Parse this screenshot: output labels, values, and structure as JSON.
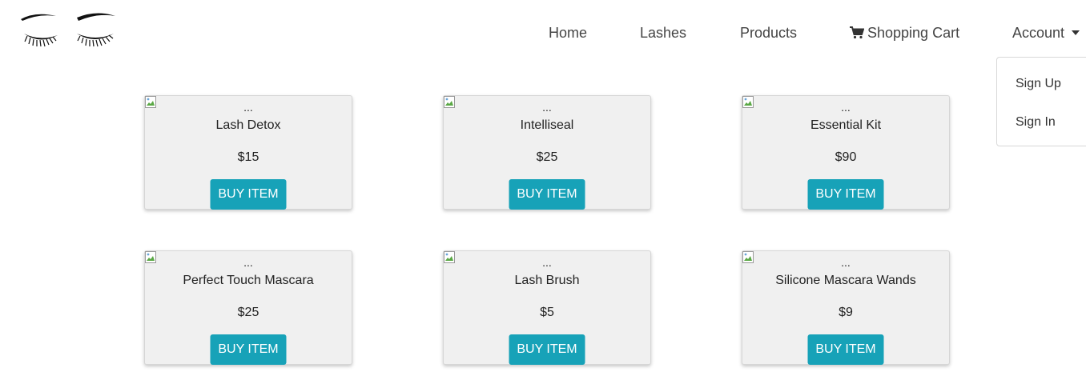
{
  "nav": {
    "home": "Home",
    "lashes": "Lashes",
    "products": "Products",
    "cart": "Shopping Cart",
    "account": "Account"
  },
  "account_menu": {
    "items": [
      "Sign Up",
      "Sign In"
    ]
  },
  "products": [
    {
      "alt": "...",
      "name": "Lash Detox",
      "price": "$15",
      "button": "BUY ITEM"
    },
    {
      "alt": "...",
      "name": "Intelliseal",
      "price": "$25",
      "button": "BUY ITEM"
    },
    {
      "alt": "...",
      "name": "Essential Kit",
      "price": "$90",
      "button": "BUY ITEM"
    },
    {
      "alt": "...",
      "name": "Perfect Touch Mascara",
      "price": "$25",
      "button": "BUY ITEM"
    },
    {
      "alt": "...",
      "name": "Lash Brush",
      "price": "$5",
      "button": "BUY ITEM"
    },
    {
      "alt": "...",
      "name": "Silicone Mascara Wands",
      "price": "$9",
      "button": "BUY ITEM"
    }
  ],
  "colors": {
    "button": "#17a2b8",
    "card_bg": "#f0f0f0"
  },
  "icons": [
    "eyelashes-logo",
    "shopping-cart-icon",
    "caret-down-icon",
    "broken-image-icon"
  ]
}
